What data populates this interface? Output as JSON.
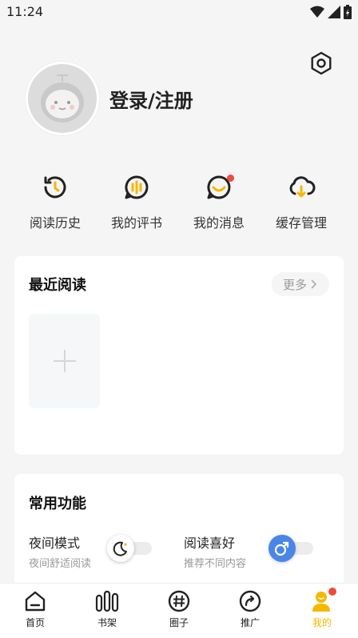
{
  "status_bar": {
    "time": "11:24"
  },
  "profile": {
    "login_label": "登录/注册"
  },
  "quick_actions": [
    {
      "label": "阅读历史",
      "icon": "history-icon"
    },
    {
      "label": "我的评书",
      "icon": "comment-icon"
    },
    {
      "label": "我的消息",
      "icon": "message-icon",
      "badge": true
    },
    {
      "label": "缓存管理",
      "icon": "cloud-download-icon"
    }
  ],
  "recent_reading": {
    "title": "最近阅读",
    "more_label": "更多"
  },
  "common_functions": {
    "title": "常用功能",
    "items": [
      {
        "title": "夜间模式",
        "subtitle": "夜间舒适阅读",
        "icon": "moon-icon",
        "toggle_on": false
      },
      {
        "title": "阅读喜好",
        "subtitle": "推荐不同内容",
        "icon": "male-icon",
        "toggle_on": false
      }
    ]
  },
  "bottom_nav": [
    {
      "label": "首页",
      "icon": "home-icon",
      "active": false
    },
    {
      "label": "书架",
      "icon": "bookshelf-icon",
      "active": false
    },
    {
      "label": "圈子",
      "icon": "circle-hash-icon",
      "active": false
    },
    {
      "label": "推广",
      "icon": "share-icon",
      "active": false
    },
    {
      "label": "我的",
      "icon": "profile-icon",
      "active": true,
      "badge": true
    }
  ],
  "colors": {
    "accent": "#f5b800",
    "badge": "#ef4a3c",
    "toggle_blue": "#4a86e8"
  }
}
